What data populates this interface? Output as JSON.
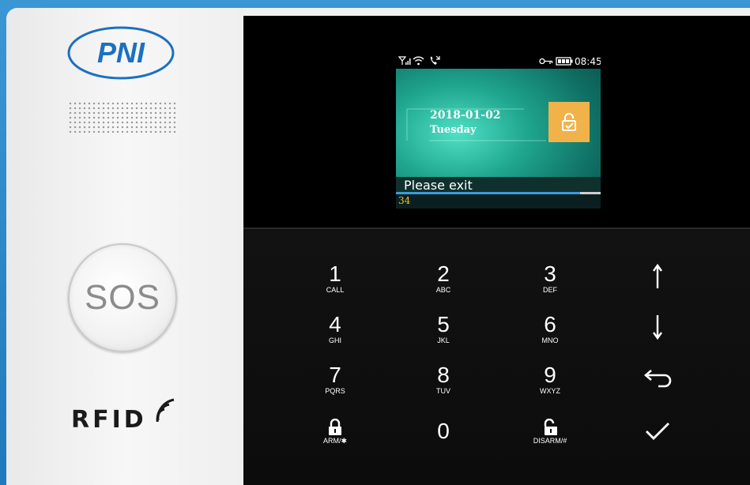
{
  "brand": {
    "logo_text": "PNI"
  },
  "sos": {
    "label": "SOS"
  },
  "rfid": {
    "label": "RFID"
  },
  "screen": {
    "status": {
      "time": "08:45"
    },
    "date": "2018-01-02",
    "weekday": "Tuesday",
    "message": "Please exit",
    "countdown": "34",
    "progress": 0.9
  },
  "keypad": {
    "k1": {
      "digit": "1",
      "sub": "CALL"
    },
    "k2": {
      "digit": "2",
      "sub": "ABC"
    },
    "k3": {
      "digit": "3",
      "sub": "DEF"
    },
    "k4": {
      "digit": "4",
      "sub": "GHI"
    },
    "k5": {
      "digit": "5",
      "sub": "JKL"
    },
    "k6": {
      "digit": "6",
      "sub": "MNO"
    },
    "k7": {
      "digit": "7",
      "sub": "PQRS"
    },
    "k8": {
      "digit": "8",
      "sub": "TUV"
    },
    "k9": {
      "digit": "9",
      "sub": "WXYZ"
    },
    "k0": {
      "digit": "0"
    },
    "arm": {
      "sub": "ARM/✱"
    },
    "disarm": {
      "sub": "DISARM/#"
    }
  },
  "icons": [
    "signal-icon",
    "wifi-icon",
    "phone-icon",
    "key-icon",
    "battery-icon",
    "unlock-icon",
    "lock-icon",
    "arrow-up-icon",
    "arrow-down-icon",
    "back-icon",
    "check-icon",
    "rfid-waves-icon"
  ],
  "colors": {
    "accent": "#f1b24a",
    "progress": "#3b9bd9",
    "countdown": "#f0c419",
    "frame": "#2b86c6"
  }
}
